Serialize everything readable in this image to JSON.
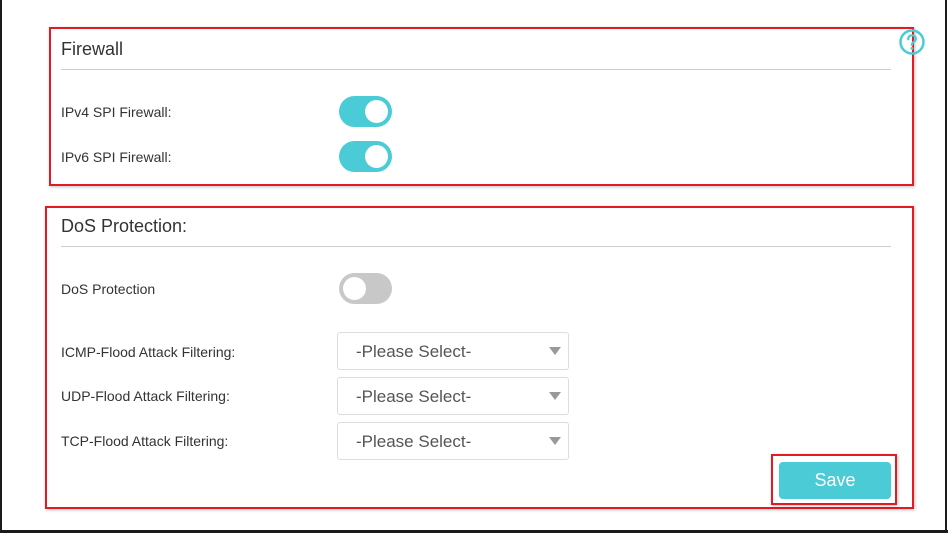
{
  "firewall": {
    "title": "Firewall",
    "ipv4_label": "IPv4 SPI Firewall:",
    "ipv4_enabled": true,
    "ipv6_label": "IPv6 SPI Firewall:",
    "ipv6_enabled": true
  },
  "dos": {
    "title": "DoS Protection:",
    "protection_label": "DoS Protection",
    "protection_enabled": false,
    "icmp_label": "ICMP-Flood Attack Filtering:",
    "icmp_value": "-Please Select-",
    "udp_label": "UDP-Flood Attack Filtering:",
    "udp_value": "-Please Select-",
    "tcp_label": "TCP-Flood Attack Filtering:",
    "tcp_value": "-Please Select-"
  },
  "actions": {
    "save_label": "Save"
  },
  "icons": {
    "help": "help-icon",
    "dropdown": "chevron-down-icon"
  },
  "colors": {
    "accent": "#4acbd6",
    "toggle_off": "#c8c8c8",
    "highlight": "#e01b24",
    "text": "#333333"
  }
}
